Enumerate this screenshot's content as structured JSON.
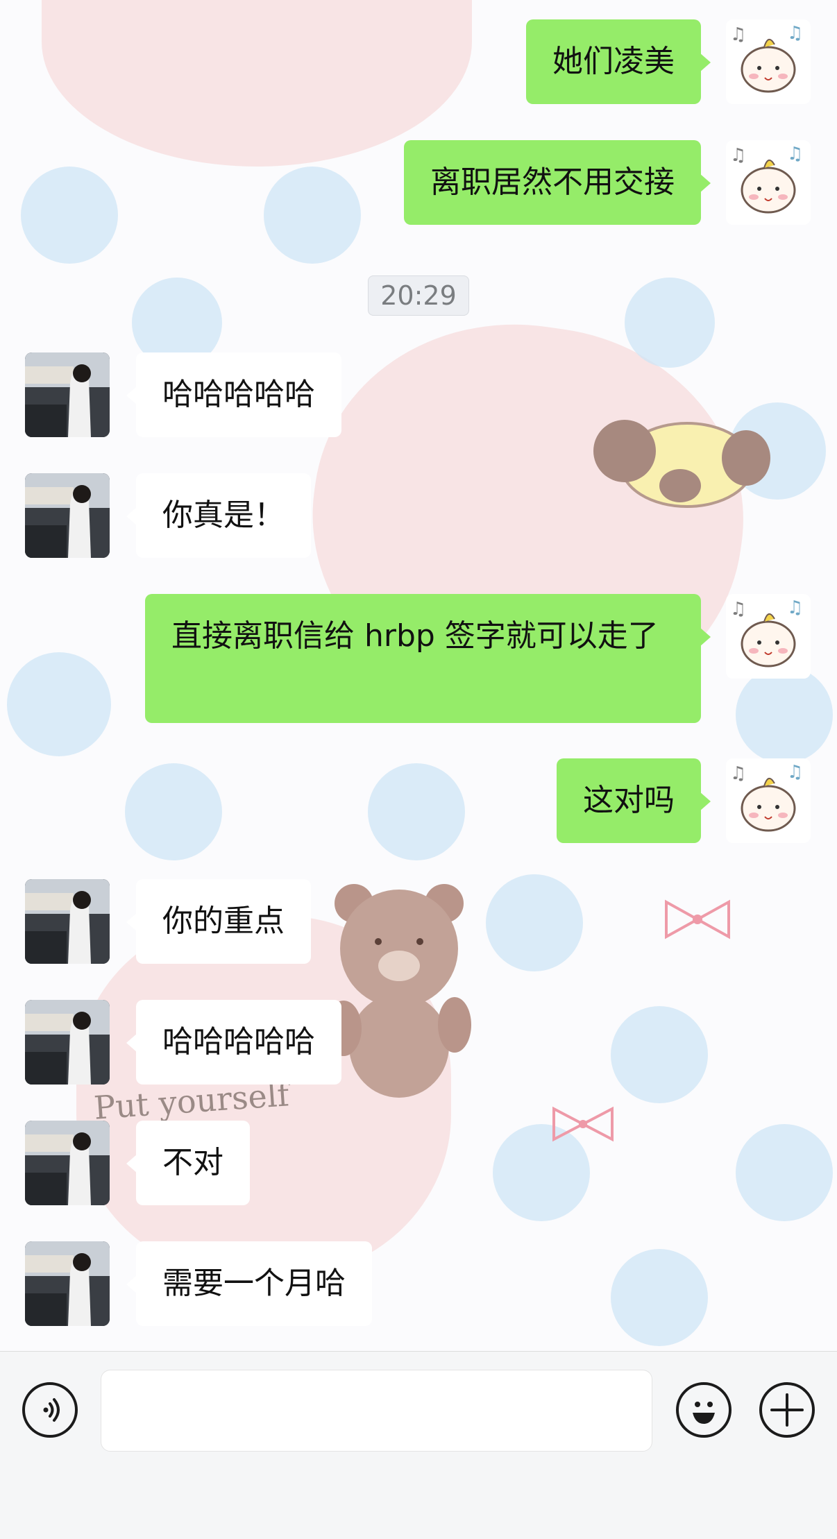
{
  "chat": {
    "time_label": "20:29",
    "messages": [
      {
        "sender": "self",
        "text": "她们凌美"
      },
      {
        "sender": "self",
        "text": "离职居然不用交接"
      },
      {
        "sender": "other",
        "text": "哈哈哈哈哈"
      },
      {
        "sender": "other",
        "text": "你真是！"
      },
      {
        "sender": "self",
        "text": "直接离职信给 hrbp 签字就可以走了"
      },
      {
        "sender": "self",
        "text": "这对吗"
      },
      {
        "sender": "other",
        "text": "你的重点"
      },
      {
        "sender": "other",
        "text": "哈哈哈哈哈"
      },
      {
        "sender": "other",
        "text": "不对"
      },
      {
        "sender": "other",
        "text": "需要一个月哈"
      }
    ]
  },
  "wallpaper": {
    "doodle_text": "Put yourself"
  },
  "input_bar": {
    "message_value": "",
    "voice_icon": "voice-icon",
    "emoji_icon": "emoji-icon",
    "plus_icon": "plus-icon"
  },
  "colors": {
    "self_bubble": "#95ec69",
    "other_bubble": "#ffffff",
    "input_bar_bg": "#f5f6f7"
  }
}
